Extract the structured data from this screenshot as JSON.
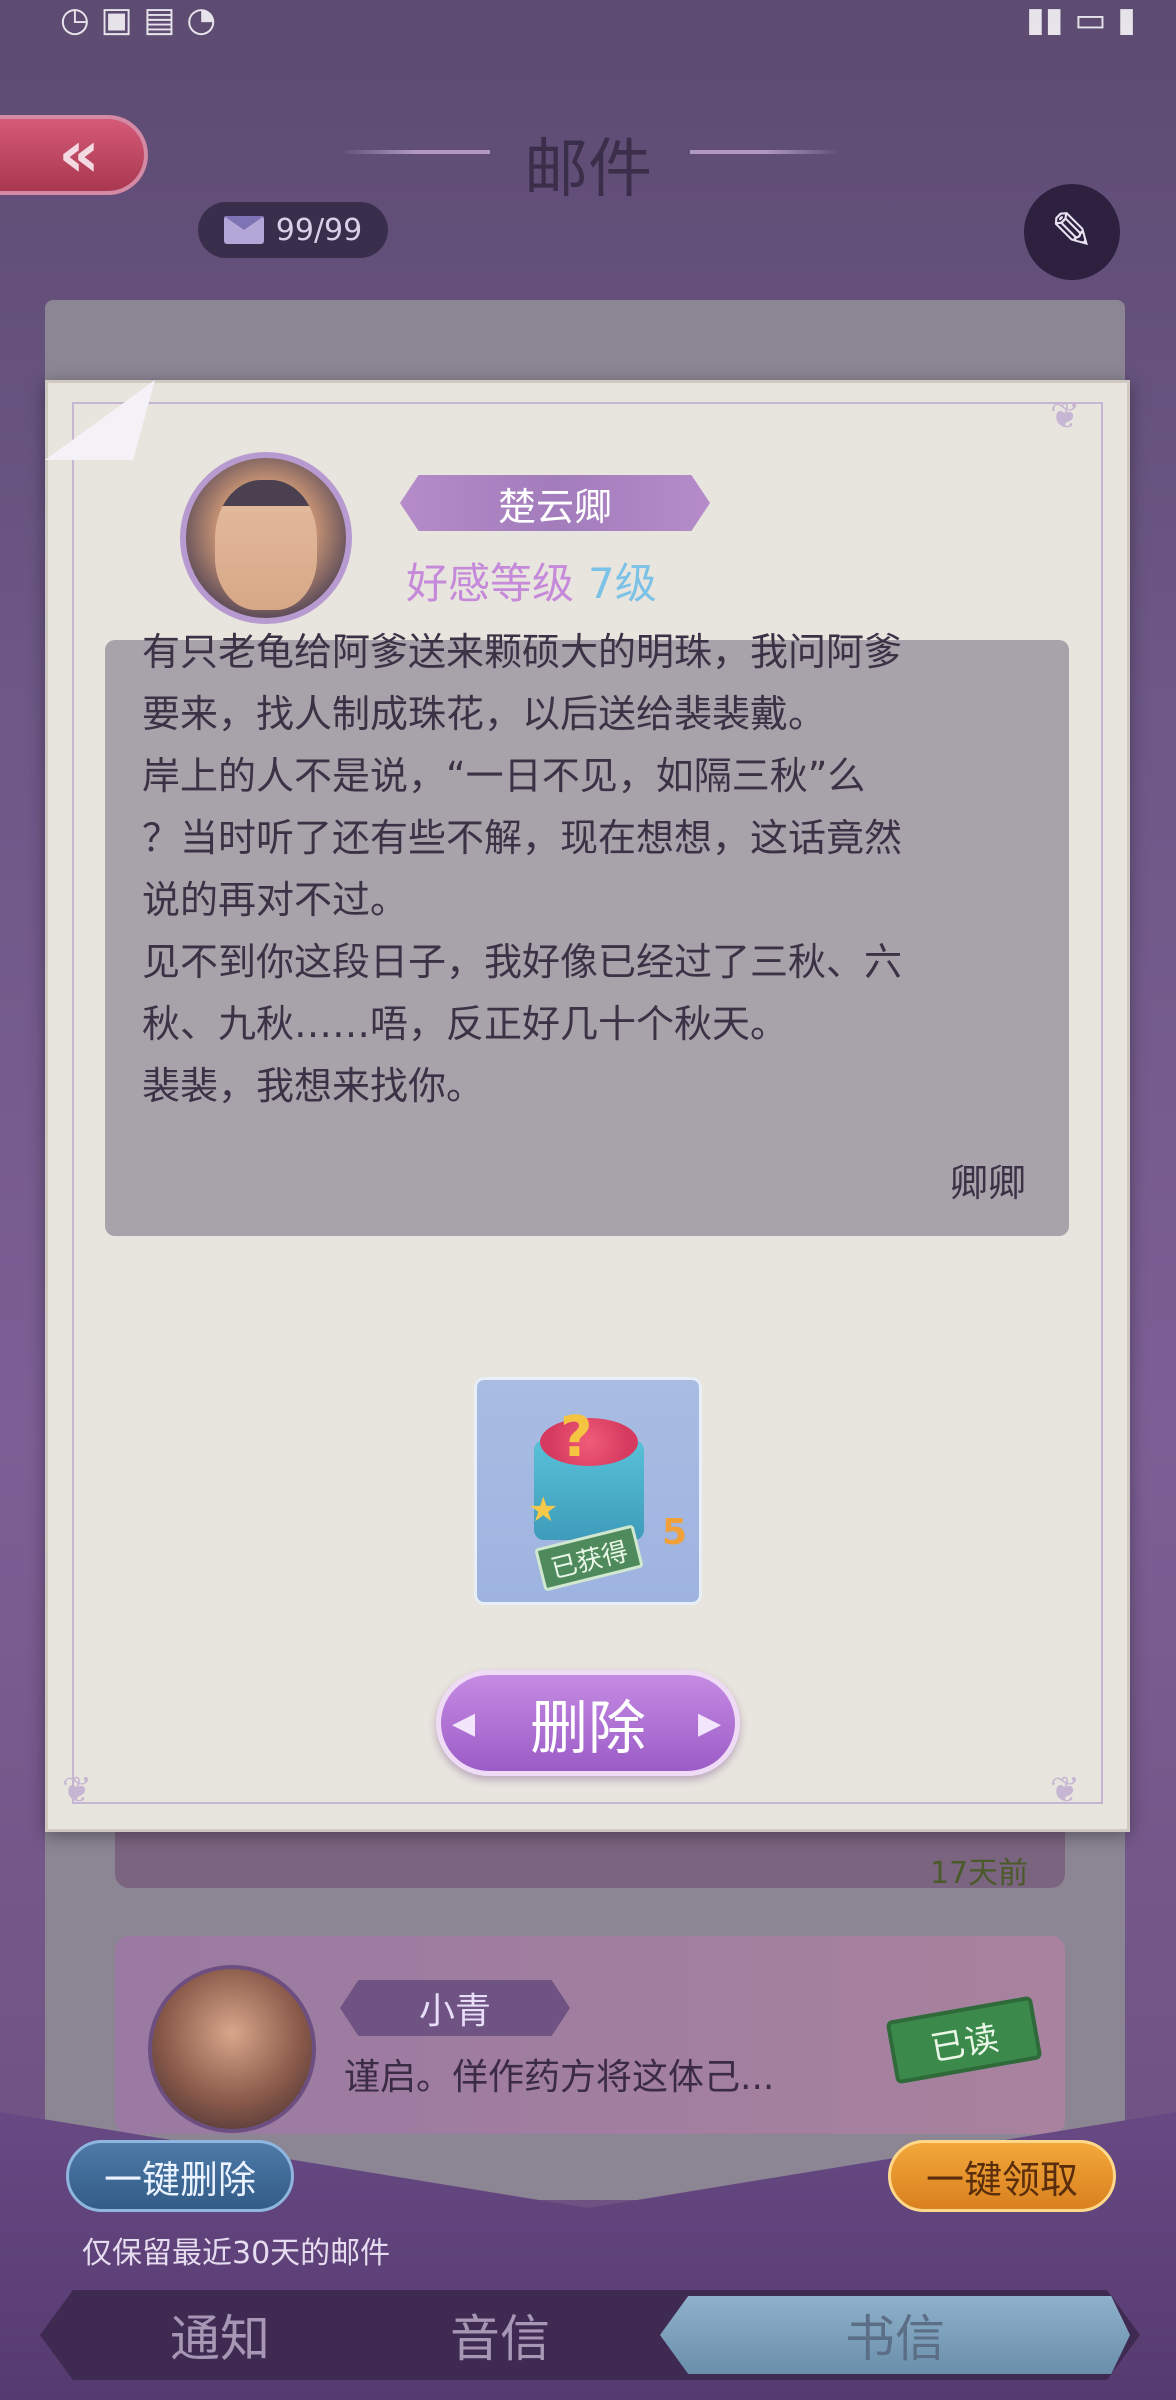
{
  "status_bar": {
    "left": "◷ ▣ ▤ ◔",
    "right": "▮▮ ▭ ▮"
  },
  "header": {
    "back_icon": "«",
    "title": "邮件",
    "mail_count": "99/99",
    "edit_icon": "✎"
  },
  "letter": {
    "sender": "楚云卿",
    "affinity_label": "好感等级",
    "affinity_level": "7级",
    "lines": [
      "有只老龟给阿爹送来颗硕大的明珠，我问阿爹",
      "要来，找人制成珠花，以后送给裴裴戴。",
      "岸上的人不是说，“一日不见，如隔三秋”么",
      "？当时听了还有些不解，现在想想，这话竟然",
      "说的再对不过。",
      "见不到你这段日子，我好像已经过了三秋、六",
      "秋、九秋……唔，反正好几十个秋天。",
      "裴裴，我想来找你。"
    ],
    "signature": "卿卿",
    "reward_count": "5",
    "reward_status": "已获得",
    "delete_label": "删除"
  },
  "list": {
    "item1_time": "17天前",
    "item2_sender": "小青",
    "item2_preview": "谨启。佯作药方将这体己...",
    "item2_status": "已读"
  },
  "bottom": {
    "delete_all": "一键删除",
    "claim_all": "一键领取",
    "note": "仅保留最近30天的邮件"
  },
  "tabs": {
    "notice": "通知",
    "voice": "音信",
    "letter": "书信"
  }
}
